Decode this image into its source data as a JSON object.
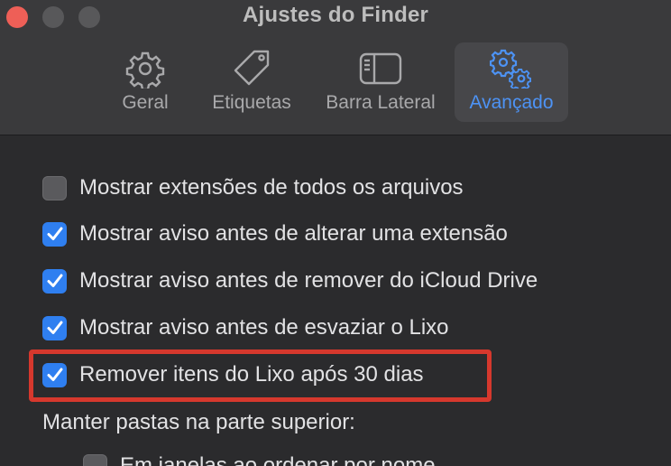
{
  "window": {
    "title": "Ajustes do Finder"
  },
  "tabs": [
    {
      "label": "Geral",
      "icon": "gear-icon",
      "selected": false
    },
    {
      "label": "Etiquetas",
      "icon": "tag-icon",
      "selected": false
    },
    {
      "label": "Barra Lateral",
      "icon": "sidebar-icon",
      "selected": false
    },
    {
      "label": "Avançado",
      "icon": "gears-icon",
      "selected": true
    }
  ],
  "options": [
    {
      "label": "Mostrar extensões de todos os arquivos",
      "checked": false
    },
    {
      "label": "Mostrar aviso antes de alterar uma extensão",
      "checked": true
    },
    {
      "label": "Mostrar aviso antes de remover do iCloud Drive",
      "checked": true
    },
    {
      "label": "Mostrar aviso antes de esvaziar o Lixo",
      "checked": true
    },
    {
      "label": "Remover itens do Lixo após 30 dias",
      "checked": true
    }
  ],
  "section": {
    "label": "Manter pastas na parte superior:"
  },
  "sub_options": [
    {
      "label": "Em janelas ao ordenar por nome",
      "checked": false
    }
  ],
  "colors": {
    "accent": "#2f7ff0",
    "selected_tab_text": "#4d93f5",
    "highlight": "#d6382d",
    "close": "#ee5f57"
  }
}
